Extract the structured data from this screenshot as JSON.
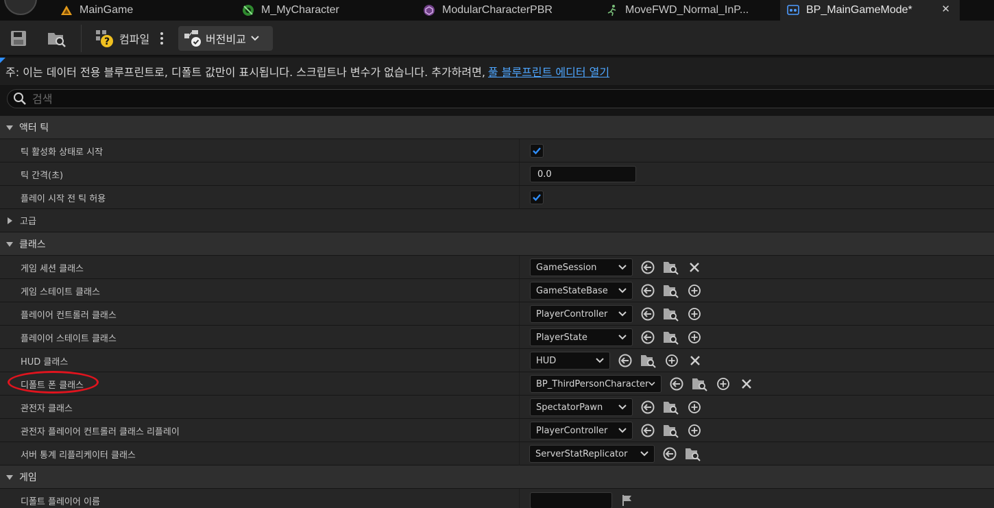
{
  "tabs": [
    {
      "label": "MainGame",
      "icon": "level-icon"
    },
    {
      "label": "M_MyCharacter",
      "icon": "material-icon"
    },
    {
      "label": "ModularCharacterPBR",
      "icon": "material-instance-icon"
    },
    {
      "label": "MoveFWD_Normal_InP...",
      "icon": "animation-icon"
    },
    {
      "label": "BP_MainGameMode*",
      "icon": "blueprint-icon",
      "active": true
    }
  ],
  "toolbar": {
    "compile_label": "컴파일",
    "version_label": "버전비교"
  },
  "notice": {
    "text": "주: 이는 데이터 전용 블루프린트로, 디폴트 값만이 표시됩니다. 스크립트나 변수가 없습니다. 추가하려면,",
    "link": "풀 블루프린트 에디터 열기"
  },
  "search": {
    "placeholder": "검색",
    "value": ""
  },
  "categories": {
    "actor_tick": "액터 틱",
    "advanced": "고급",
    "classes": "클래스",
    "game": "게임"
  },
  "tick": {
    "start_enabled_label": "틱 활성화 상태로 시작",
    "start_enabled": true,
    "interval_label": "틱 간격(초)",
    "interval_value": "0.0",
    "allow_before_play_label": "플레이 시작 전 틱 허용",
    "allow_before_play": true
  },
  "classes": [
    {
      "label": "게임 세션 클래스",
      "value": "GameSession",
      "action": "clear"
    },
    {
      "label": "게임 스테이트 클래스",
      "value": "GameStateBase",
      "action": "add"
    },
    {
      "label": "플레이어 컨트롤러 클래스",
      "value": "PlayerController",
      "action": "add"
    },
    {
      "label": "플레이어 스테이트 클래스",
      "value": "PlayerState",
      "action": "add"
    },
    {
      "label": "HUD 클래스",
      "value": "HUD",
      "action": "add-clear"
    },
    {
      "label": "디폴트 폰 클래스",
      "value": "BP_ThirdPersonCharacter",
      "action": "add-clear"
    },
    {
      "label": "관전자 클래스",
      "value": "SpectatorPawn",
      "action": "add"
    },
    {
      "label": "관전자 플레이어 컨트롤러 클래스 리플레이",
      "value": "PlayerController",
      "action": "add"
    },
    {
      "label": "서버 통계 리플리케이터 클래스",
      "value": "ServerStatReplicator",
      "action": "none"
    }
  ],
  "game": {
    "default_player_name_label": "디폴트 플레이어 이름",
    "default_player_name": ""
  },
  "colors": {
    "accent": "#2f8fff",
    "link": "#4ea6ff",
    "annotation": "#e0141e"
  }
}
